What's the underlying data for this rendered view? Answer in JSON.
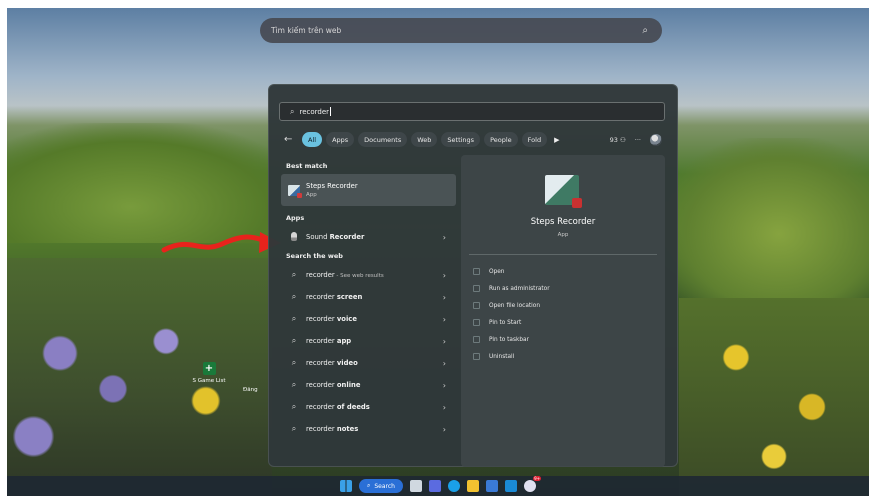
{
  "web_search": {
    "placeholder": "Tìm kiếm trên web"
  },
  "desktop": {
    "icons": [
      {
        "label": "S Game List"
      },
      {
        "label": "Đăng"
      }
    ]
  },
  "start_search": {
    "query": "recorder",
    "filters": [
      "All",
      "Apps",
      "Documents",
      "Web",
      "Settings",
      "People",
      "Fold"
    ],
    "active_filter": "All",
    "points": "93",
    "more": "···",
    "best_match": {
      "heading": "Best match",
      "title": "Steps Recorder",
      "subtitle": "App"
    },
    "apps": {
      "heading": "Apps",
      "items": [
        {
          "prefix": "Sound ",
          "bold": "Recorder"
        }
      ]
    },
    "web": {
      "heading": "Search the web",
      "items": [
        {
          "prefix": "recorder",
          "bold": "",
          "sub": " - See web results"
        },
        {
          "prefix": "recorder ",
          "bold": "screen",
          "sub": ""
        },
        {
          "prefix": "recorder ",
          "bold": "voice",
          "sub": ""
        },
        {
          "prefix": "recorder ",
          "bold": "app",
          "sub": ""
        },
        {
          "prefix": "recorder ",
          "bold": "video",
          "sub": ""
        },
        {
          "prefix": "recorder ",
          "bold": "online",
          "sub": ""
        },
        {
          "prefix": "recorder ",
          "bold": "of deeds",
          "sub": ""
        },
        {
          "prefix": "recorder ",
          "bold": "notes",
          "sub": ""
        }
      ]
    },
    "preview": {
      "title": "Steps Recorder",
      "subtitle": "App",
      "actions": [
        "Open",
        "Run as administrator",
        "Open file location",
        "Pin to Start",
        "Pin to taskbar",
        "Uninstall"
      ]
    }
  },
  "taskbar": {
    "search_label": "Search"
  },
  "colors": {
    "accent": "#6ac2e0",
    "panel": "#30383a"
  }
}
